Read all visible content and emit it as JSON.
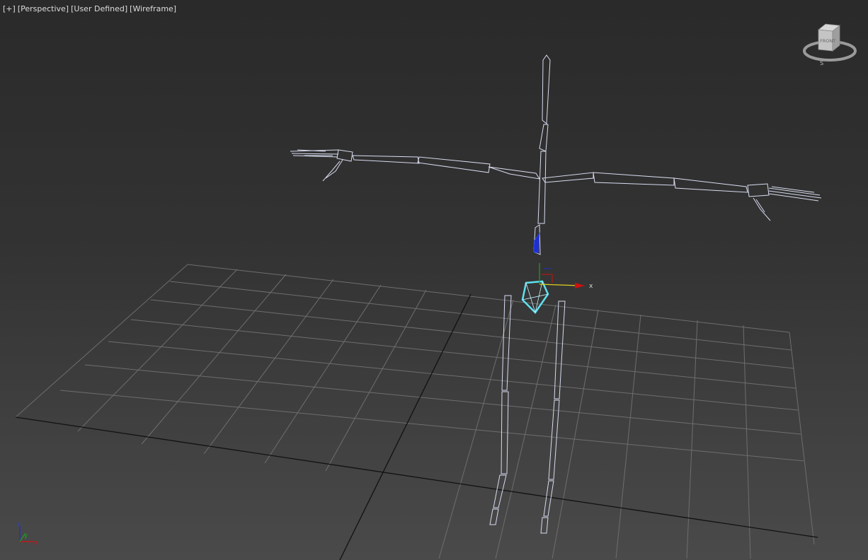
{
  "viewport": {
    "menu_plus": "[+]",
    "view_type": "[Perspective]",
    "user_defined": "[User Defined]",
    "shading": "[Wireframe]"
  },
  "viewcube": {
    "face_label": "FRONT",
    "compass_label": "S"
  },
  "gizmo": {
    "x_label": "x"
  },
  "axis_tripod": {
    "x_label": "x",
    "y_label": "y",
    "z_label": "z"
  },
  "colors": {
    "wireframe": "#d8dcf0",
    "selected": "#5fe0f0",
    "grid": "#7a7a7a",
    "grid_axis": "#111111",
    "x_axis": "#d01010",
    "y_axis": "#20a020",
    "z_axis": "#2030c0",
    "gizmo_yellow": "#e0d020"
  }
}
